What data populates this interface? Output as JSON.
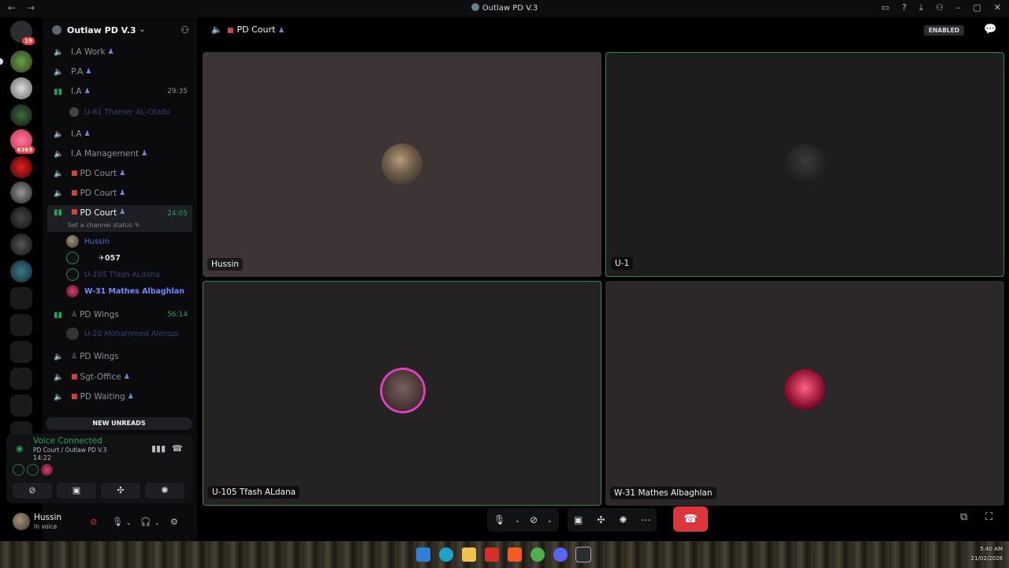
{
  "window": {
    "title": "Outlaw PD V.3",
    "nav_back": "←",
    "nav_forward": "→"
  },
  "rail": {
    "home_badge": "19",
    "server_badge": "6363"
  },
  "guild": {
    "name": "Outlaw PD V.3"
  },
  "channels": [
    {
      "label": "I.A Work",
      "time": ""
    },
    {
      "label": "P.A",
      "time": ""
    },
    {
      "label": "I.A",
      "time": "29:35"
    },
    {
      "label": "I.A",
      "time": ""
    },
    {
      "label": "I.A Management",
      "time": ""
    },
    {
      "label": "PD Court",
      "time": ""
    },
    {
      "label": "PD Court",
      "time": ""
    },
    {
      "label": "PD Court",
      "time": "24:05"
    },
    {
      "label": "PD Wings",
      "time": "56:14"
    },
    {
      "label": "PD Wings",
      "time": ""
    },
    {
      "label": "Sgt-Office",
      "time": ""
    },
    {
      "label": "PD Waiting",
      "time": ""
    }
  ],
  "channel_status": "Set a channel status",
  "members": {
    "ia_member": "U-61 Thamer AL-Otaibi",
    "court": [
      "Hussin",
      "057",
      "U-105 Tfash ALdana",
      "W-31 Mathes Albaghlan"
    ],
    "wings_member": "U-20 Mohammed Alenazi"
  },
  "sidebar": {
    "new_unreads": "NEW UNREADS"
  },
  "voice": {
    "status": "Voice Connected",
    "location": "PD Court  / Outlaw PD V.3",
    "timer": "14:22"
  },
  "user": {
    "name": "Hussin",
    "status": "In voice"
  },
  "main": {
    "title": "PD Court",
    "enabled_badge": "ENABLED"
  },
  "tiles": [
    {
      "name": "Hussin"
    },
    {
      "name": "U-1"
    },
    {
      "name": "U-105 Tfash ALdana"
    },
    {
      "name": "W-31 Mathes Albaghlan"
    }
  ],
  "tray": {
    "time": "5:40 AM",
    "date": "21/02/2026"
  },
  "colors": {
    "voice_green": "#23a55a",
    "end_call_red": "#da373c",
    "mention_blue": "#4e6bd1"
  }
}
